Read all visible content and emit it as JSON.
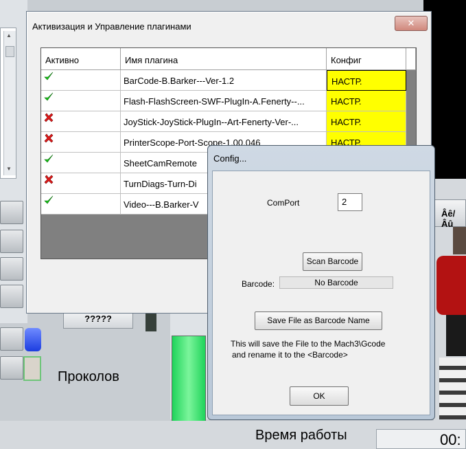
{
  "background": {
    "unknown_button": "?????",
    "label_punctures": "Проколов",
    "label_runtime": "Время работы",
    "runtime_value": "00:",
    "right_button_label": "Âê/Âû"
  },
  "plugin_window": {
    "title": "Активизация и Управление плагинами",
    "close_symbol": "✕",
    "columns": {
      "active": "Активно",
      "name": "Имя плагина",
      "config": "Конфиг"
    },
    "rows": [
      {
        "active": true,
        "name": "BarCode-B.Barker---Ver-1.2",
        "config": "НАСТР."
      },
      {
        "active": true,
        "name": "Flash-FlashScreen-SWF-PlugIn-A.Fenerty--...",
        "config": "НАСТР."
      },
      {
        "active": false,
        "name": "JoyStick-JoyStick-PlugIn--Art-Fenerty-Ver-...",
        "config": "НАСТР."
      },
      {
        "active": false,
        "name": "PrinterScope-Port-Scope-1.00.046",
        "config": "НАСТР."
      },
      {
        "active": true,
        "name": "SheetCamRemote",
        "config": ""
      },
      {
        "active": false,
        "name": "TurnDiags-Turn-Di",
        "config": ""
      },
      {
        "active": true,
        "name": "Video---B.Barker-V",
        "config": ""
      }
    ],
    "icons": {
      "active": "green-check-icon",
      "inactive": "red-x-icon"
    },
    "colors": {
      "config_cell": "#ffff00"
    }
  },
  "config_dialog": {
    "title": "Config...",
    "comport_label": "ComPort",
    "comport_value": "2",
    "scan_button": "Scan Barcode",
    "barcode_label": "Barcode:",
    "barcode_value": "No Barcode",
    "save_button": "Save File as Barcode Name",
    "info_line1": "This will save the File to the Mach3\\Gcode",
    "info_line2": "and rename it to the <Barcode>",
    "ok_button": "OK"
  }
}
